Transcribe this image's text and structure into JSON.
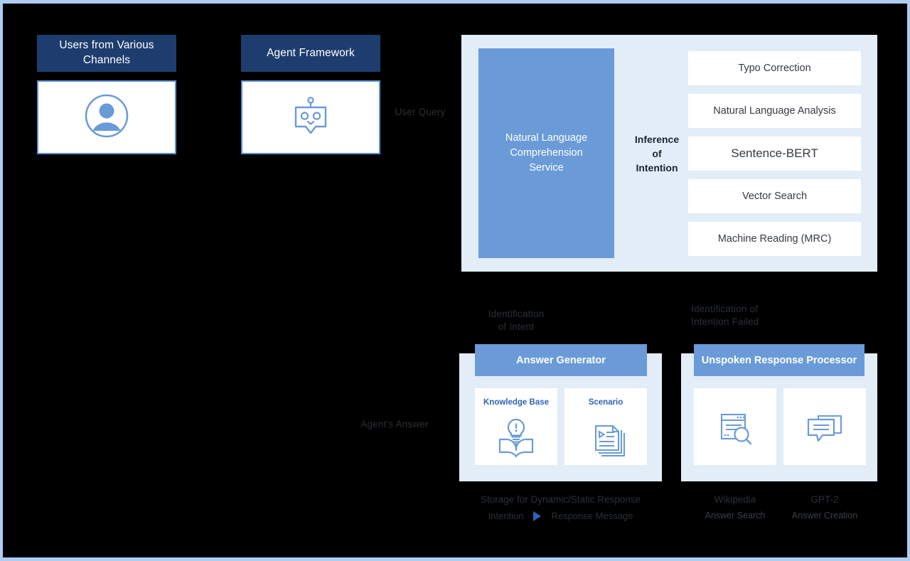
{
  "theme": {
    "background": "#000000",
    "frame_border": "#aecdf0",
    "navy": "#1d3d6e",
    "blue": "#6a9bd8",
    "panel_bg": "#e3edf8",
    "accent_text": "#2f63b5",
    "white": "#ffffff"
  },
  "sources": [
    {
      "title": "Users from Various Channels",
      "icon": "user-avatar-icon"
    },
    {
      "title": "Agent Framework",
      "icon": "chatbot-icon"
    }
  ],
  "flows": {
    "user_query": "User Query",
    "agents_answer": "Agent's Answer",
    "identification_of_intent": "Identification\nof Intent",
    "identification_failed": "Identification of\nIntention Failed"
  },
  "nlu": {
    "service_name": "Natural Language Comprehension Service",
    "connector_label": "Inference\nof\nIntention",
    "items": [
      {
        "label": "Typo Correction",
        "emphasis": false
      },
      {
        "label": "Natural Language Analysis",
        "emphasis": false
      },
      {
        "label": "Sentence-BERT",
        "emphasis": true
      },
      {
        "label": "Vector Search",
        "emphasis": false
      },
      {
        "label": "Machine Reading (MRC)",
        "emphasis": false
      }
    ]
  },
  "answer_generator": {
    "title": "Answer Generator",
    "tiles": [
      {
        "label": "Knowledge Base",
        "icon": "lightbulb-book-icon"
      },
      {
        "label": "Scenario",
        "icon": "document-stack-play-icon"
      }
    ],
    "caption": "Storage for Dynamic/Static Response",
    "mapping": {
      "from": "Intention",
      "arrow": "triangle-right-icon",
      "to": "Response Message"
    }
  },
  "unspoken_processor": {
    "title": "Unspoken Response Processor",
    "tiles": [
      {
        "icon": "document-search-icon",
        "caption": "Wikipedia",
        "subcaption": "Answer Search"
      },
      {
        "icon": "chat-bubbles-icon",
        "caption": "GPT-2",
        "subcaption": "Answer Creation"
      }
    ]
  }
}
